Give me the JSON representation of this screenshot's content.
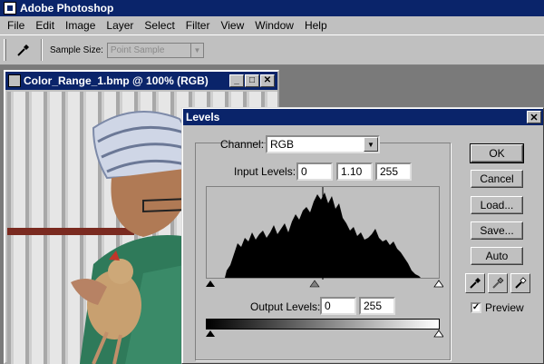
{
  "app": {
    "title": "Adobe Photoshop"
  },
  "menu": [
    "File",
    "Edit",
    "Image",
    "Layer",
    "Select",
    "Filter",
    "View",
    "Window",
    "Help"
  ],
  "options": {
    "sample_label": "Sample Size:",
    "sample_value": "Point Sample"
  },
  "document": {
    "title": "Color_Range_1.bmp @ 100% (RGB)"
  },
  "levels": {
    "title": "Levels",
    "channel_label": "Channel:",
    "channel_value": "RGB",
    "input_label": "Input Levels:",
    "input_black": "0",
    "input_gamma": "1.10",
    "input_white": "255",
    "output_label": "Output Levels:",
    "output_black": "0",
    "output_white": "255",
    "buttons": {
      "ok": "OK",
      "cancel": "Cancel",
      "load": "Load...",
      "save": "Save...",
      "auto": "Auto"
    },
    "preview_label": "Preview",
    "preview_checked": true
  },
  "colors": {
    "titlebar": "#0a246a",
    "chrome": "#c0c0c0",
    "workspace": "#7a7a7a"
  },
  "icons": [
    "eyedropper-icon",
    "minimize-icon",
    "maximize-icon",
    "close-icon",
    "black-eyedropper-icon",
    "gray-eyedropper-icon",
    "white-eyedropper-icon"
  ]
}
